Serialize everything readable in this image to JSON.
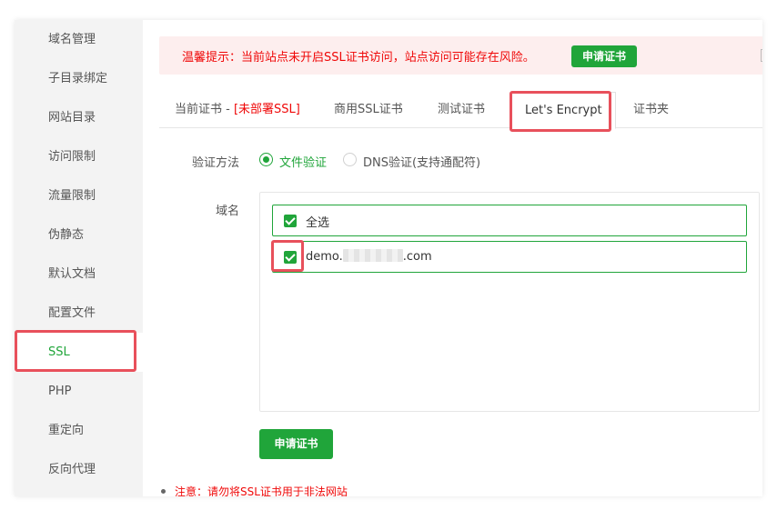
{
  "sidebar": {
    "items": [
      {
        "label": "域名管理"
      },
      {
        "label": "子目录绑定"
      },
      {
        "label": "网站目录"
      },
      {
        "label": "访问限制"
      },
      {
        "label": "流量限制"
      },
      {
        "label": "伪静态"
      },
      {
        "label": "默认文档"
      },
      {
        "label": "配置文件"
      },
      {
        "label": "SSL",
        "active": true
      },
      {
        "label": "PHP"
      },
      {
        "label": "重定向"
      },
      {
        "label": "反向代理"
      }
    ]
  },
  "alert": {
    "text": "温馨提示：当前站点未开启SSL证书访问，站点访问可能存在风险。",
    "button": "申请证书"
  },
  "tabs": {
    "current_prefix": "当前证书 - ",
    "current_status": "[未部署SSL]",
    "commercial": "商用SSL证书",
    "test": "测试证书",
    "letsencrypt": "Let's Encrypt",
    "folder": "证书夹"
  },
  "verify": {
    "label": "验证方法",
    "options": [
      {
        "label": "文件验证",
        "selected": true
      },
      {
        "label": "DNS验证(支持通配符)",
        "selected": false
      }
    ]
  },
  "domains": {
    "label": "域名",
    "select_all": "全选",
    "items": [
      {
        "prefix": "demo.",
        "suffix": ".com",
        "checked": true
      }
    ]
  },
  "apply_button": "申请证书",
  "note": "注意：请勿将SSL证书用于非法网站",
  "colors": {
    "accent": "#20a53a",
    "warning": "#ef0808",
    "highlight": "#e8505b",
    "alert_bg": "#fdeeee"
  }
}
